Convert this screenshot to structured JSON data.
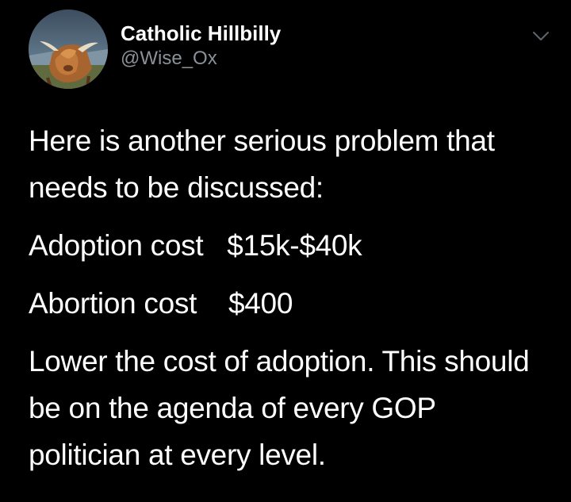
{
  "author": {
    "display_name": "Catholic Hillbilly",
    "handle": "@Wise_Ox",
    "avatar_icon": "highland-cow-avatar"
  },
  "menu": {
    "icon": "chevron-down-icon"
  },
  "tweet": {
    "intro": "Here is another serious problem that needs to be discussed:",
    "adoption": {
      "label": "Adoption cost",
      "value": "$15k-$40k"
    },
    "abortion": {
      "label": "Abortion cost",
      "value": "$400"
    },
    "closing": "Lower the cost of adoption. This should be on the agenda of every GOP politician at every level."
  },
  "colors": {
    "background": "#000000",
    "text": "#ffffff",
    "handle": "#8a9199",
    "chevron": "#5b6670"
  }
}
